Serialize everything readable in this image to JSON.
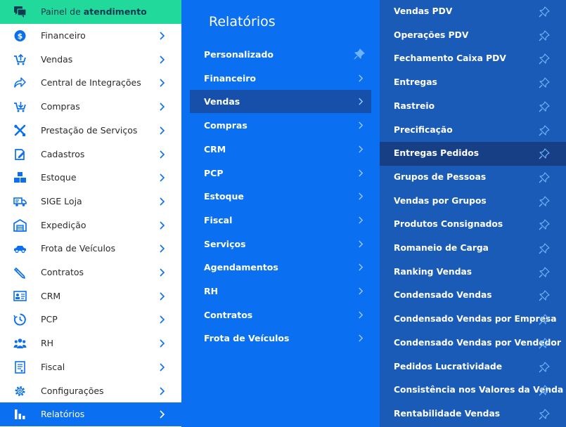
{
  "sidebar": {
    "top_item": {
      "label_prefix": "Painel de ",
      "label_strong": "atendimento",
      "icon": "chat-icon"
    },
    "items": [
      {
        "label": "Financeiro",
        "icon": "dollar-icon"
      },
      {
        "label": "Vendas",
        "icon": "cart-up-icon"
      },
      {
        "label": "Central de Integrações",
        "icon": "share-arrow-icon"
      },
      {
        "label": "Compras",
        "icon": "cart-down-icon"
      },
      {
        "label": "Prestação de Serviços",
        "icon": "tools-icon"
      },
      {
        "label": "Cadastros",
        "icon": "edit-icon"
      },
      {
        "label": "Estoque",
        "icon": "boxes-icon"
      },
      {
        "label": "SIGE Loja",
        "icon": "truck-icon"
      },
      {
        "label": "Expedição",
        "icon": "warehouse-icon"
      },
      {
        "label": "Frota de Veículos",
        "icon": "car-icon"
      },
      {
        "label": "Contratos",
        "icon": "pen-icon"
      },
      {
        "label": "CRM",
        "icon": "id-card-icon"
      },
      {
        "label": "PCP",
        "icon": "clock-icon"
      },
      {
        "label": "RH",
        "icon": "users-icon"
      },
      {
        "label": "Fiscal",
        "icon": "document-icon"
      },
      {
        "label": "Configurações",
        "icon": "gear-icon"
      },
      {
        "label": "Relatórios",
        "icon": "bar-chart-icon",
        "active": true
      }
    ]
  },
  "middle": {
    "title": "Relatórios",
    "items": [
      {
        "label": "Personalizado",
        "trailing": "pin"
      },
      {
        "label": "Financeiro",
        "trailing": "chevron"
      },
      {
        "label": "Vendas",
        "trailing": "chevron",
        "active": true
      },
      {
        "label": "Compras",
        "trailing": "chevron"
      },
      {
        "label": "CRM",
        "trailing": "chevron"
      },
      {
        "label": "PCP",
        "trailing": "chevron"
      },
      {
        "label": "Estoque",
        "trailing": "chevron"
      },
      {
        "label": "Fiscal",
        "trailing": "chevron"
      },
      {
        "label": "Serviços",
        "trailing": "chevron"
      },
      {
        "label": "Agendamentos",
        "trailing": "chevron"
      },
      {
        "label": "RH",
        "trailing": "chevron"
      },
      {
        "label": "Contratos",
        "trailing": "chevron"
      },
      {
        "label": "Frota de Veículos",
        "trailing": "chevron"
      }
    ]
  },
  "right": {
    "items": [
      {
        "label": "Vendas PDV"
      },
      {
        "label": "Operações PDV"
      },
      {
        "label": "Fechamento Caixa PDV"
      },
      {
        "label": "Entregas"
      },
      {
        "label": "Rastreio"
      },
      {
        "label": "Precificação"
      },
      {
        "label": "Entregas Pedidos",
        "active": true
      },
      {
        "label": "Grupos de Pessoas"
      },
      {
        "label": "Vendas por Grupos"
      },
      {
        "label": "Produtos Consignados"
      },
      {
        "label": "Romaneio de Carga"
      },
      {
        "label": "Ranking Vendas"
      },
      {
        "label": "Condensado Vendas"
      },
      {
        "label": "Condensado Vendas por Empresa"
      },
      {
        "label": "Condensado Vendas por Vendedor"
      },
      {
        "label": "Pedidos Lucratividade"
      },
      {
        "label": "Consistência nos Valores da Venda"
      },
      {
        "label": "Rentabilidade Vendas"
      }
    ]
  },
  "colors": {
    "top_green": "#21d99b",
    "accent_blue": "#0a6ff0",
    "middle_active": "#1650ab",
    "right_panel": "#1a5bb8",
    "right_active": "#163f85",
    "icon_blue": "#0a6ff0",
    "pin_light": "#6fb3ff"
  }
}
